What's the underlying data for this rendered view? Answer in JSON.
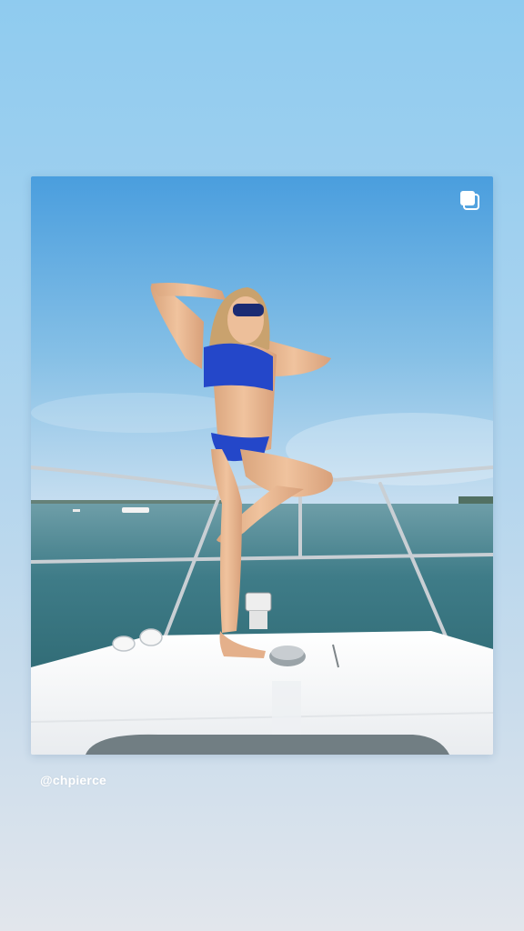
{
  "story": {
    "background_colors": [
      "#8fcbef",
      "#e2e6ec"
    ],
    "post": {
      "kind": "photo",
      "multi_image_icon": "carousel-stack-icon",
      "palette": {
        "sky_top": "#4a9ede",
        "sky_bottom": "#b8d9ee",
        "water": "#3d7a86",
        "boat_deck": "#f4f4f4",
        "swimsuit": "#2447c9",
        "skin": "#e7b791"
      }
    },
    "mention": "@chpierce"
  }
}
